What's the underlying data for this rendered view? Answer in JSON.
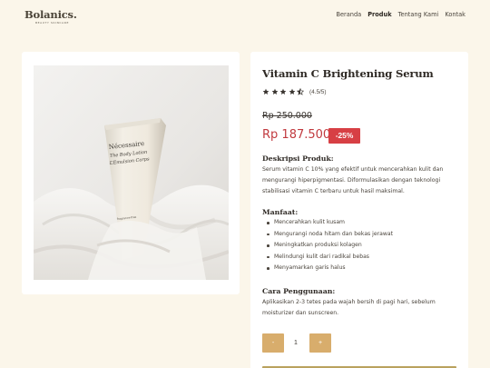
{
  "header": {
    "logo": "Bolanics.",
    "logo_sub": "BEAUTY SKINCARE",
    "nav": [
      {
        "label": "Beranda",
        "active": false
      },
      {
        "label": "Produk",
        "active": true
      },
      {
        "label": "Tentang Kami",
        "active": false
      },
      {
        "label": "Kontak",
        "active": false
      }
    ]
  },
  "product": {
    "tube_brand": "Nécessaire",
    "tube_line1": "The Body Lotion",
    "tube_line2": "L’Emulsion Corps",
    "tube_small": "fragrance-free",
    "title": "Vitamin C Brightening Serum",
    "rating_value": 4.5,
    "rating_text": "(4.5/5)",
    "old_price": "Rp 250.000",
    "new_price": "Rp 187.500",
    "discount": "-25%"
  },
  "description": {
    "heading": "Deskripsi Produk:",
    "text": "Serum vitamin C 10% yang efektif untuk mencerahkan kulit dan mengurangi hiperpigmentasi. Diformulasikan dengan teknologi stabilisasi vitamin C terbaru untuk hasil maksimal."
  },
  "benefits": {
    "heading": "Manfaat:",
    "items": [
      "Mencerahkan kulit kusam",
      "Mengurangi noda hitam dan bekas jerawat",
      "Meningkatkan produksi kolagen",
      "Melindungi kulit dari radikal bebas",
      "Menyamarkan garis halus"
    ]
  },
  "usage": {
    "heading": "Cara Penggunaan:",
    "text": "Aplikasikan 2-3 tetes pada wajah bersih di pagi hari, sebelum moisturizer dan sunscreen."
  },
  "quantity": {
    "minus": "-",
    "value": "1",
    "plus": "+"
  },
  "colors": {
    "background": "#fbf6ea",
    "accent_gold": "#d8ad6c",
    "price_red": "#c13a3f",
    "badge_red": "#d73f44",
    "star": "#3a3530"
  }
}
